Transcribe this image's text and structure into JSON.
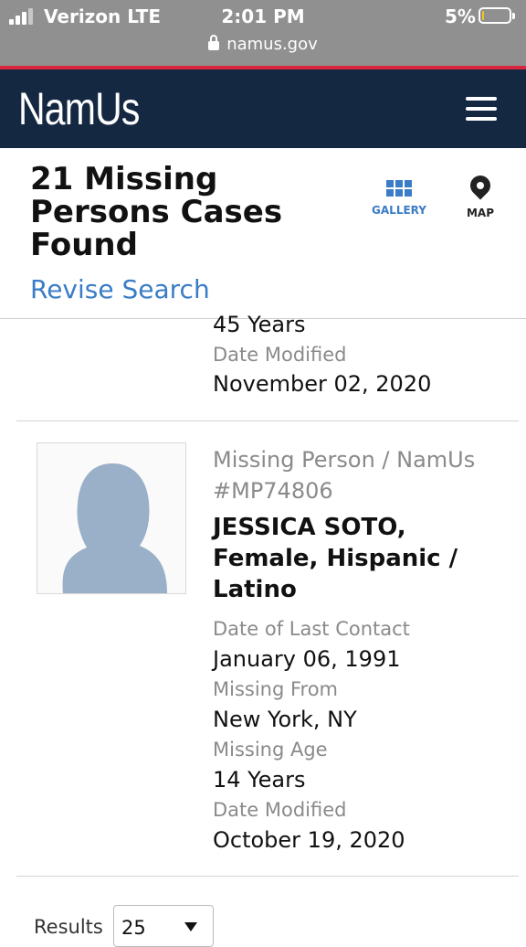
{
  "status_bar": {
    "carrier": "Verizon LTE",
    "time": "2:01 PM",
    "battery_percent": "5%",
    "battery_level": 0.05,
    "battery_color": "#f5c518",
    "url": "namus.gov",
    "icons": [
      "signal-bars-icon",
      "lock-icon",
      "battery-icon"
    ]
  },
  "header": {
    "logo": "NamUs",
    "menu_icon": "hamburger-menu-icon",
    "background": "#142842",
    "accent_stripe": "#d7263d"
  },
  "results_header": {
    "title": "21 Missing Persons Cases Found",
    "revise_link": "Revise Search",
    "views": [
      {
        "label": "GALLERY",
        "icon": "grid-icon",
        "active": true
      },
      {
        "label": "MAP",
        "icon": "map-pin-icon",
        "active": false
      }
    ],
    "link_color": "#3a7cc6"
  },
  "previous_case": {
    "missing_age_value": "45 Years",
    "date_modified_label": "Date Modified",
    "date_modified_value": "November 02, 2020"
  },
  "case": {
    "type": "Missing Person / NamUs #MP74806",
    "name": "JESSICA SOTO, Female, Hispanic / Latino",
    "photo": "female-silhouette-icon",
    "fields": [
      {
        "label": "Date of Last Contact",
        "value": "January 06, 1991"
      },
      {
        "label": "Missing From",
        "value": "New York, NY"
      },
      {
        "label": "Missing Age",
        "value": "14 Years"
      },
      {
        "label": "Date Modified",
        "value": "October 19, 2020"
      }
    ]
  },
  "pagination": {
    "results_label": "Results",
    "page_size": "25"
  }
}
